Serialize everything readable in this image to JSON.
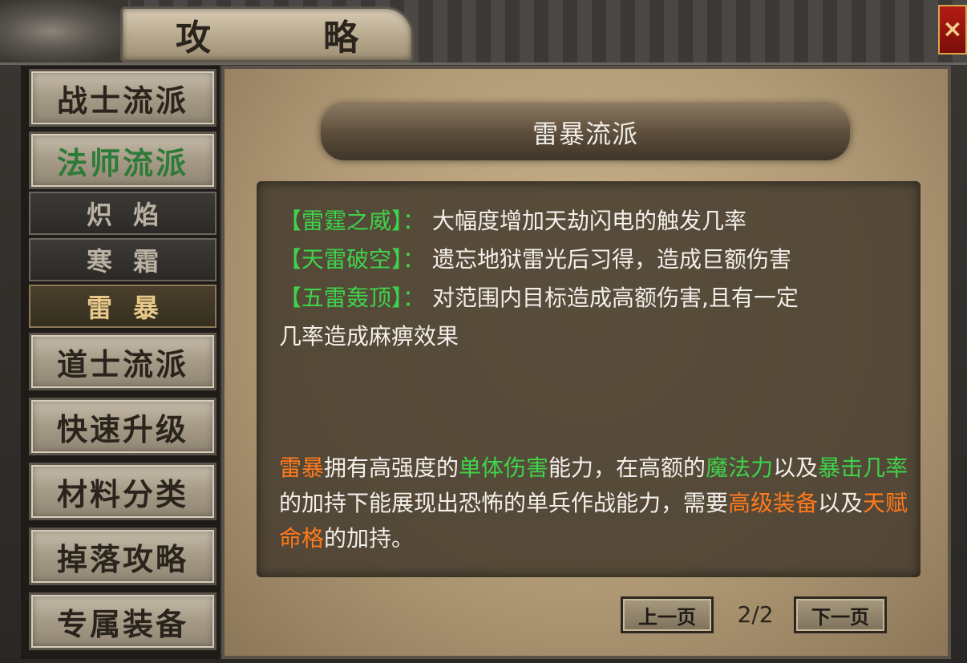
{
  "window": {
    "title": "攻　略",
    "close_label": "×"
  },
  "sidebar": {
    "items": [
      {
        "label": "战士流派",
        "active": false
      },
      {
        "label": "法师流派",
        "active": true
      },
      {
        "label": "炽焰",
        "sub": true,
        "active": false
      },
      {
        "label": "寒霜",
        "sub": true,
        "active": false
      },
      {
        "label": "雷暴",
        "sub": true,
        "active": true
      },
      {
        "label": "道士流派",
        "active": false
      },
      {
        "label": "快速升级",
        "active": false
      },
      {
        "label": "材料分类",
        "active": false
      },
      {
        "label": "掉落攻略",
        "active": false
      },
      {
        "label": "专属装备",
        "active": false
      }
    ]
  },
  "main": {
    "header": "雷暴流派",
    "skills": [
      {
        "name": "【雷霆之威】",
        "sep": "：",
        "text": "大幅度增加天劫闪电的触发几率"
      },
      {
        "name": "【天雷破空】",
        "sep": "：",
        "text": "遗忘地狱雷光后习得，造成巨额伤害"
      },
      {
        "name": "【五雷轰顶】",
        "sep": "：",
        "text": "对范围内目标造成高额伤害,且有一定"
      }
    ],
    "skill_continuation": "几率造成麻痹效果",
    "description": {
      "p1": "雷暴",
      "p2": "拥有高强度的",
      "p3": "单体伤害",
      "p4": "能力，在高额的",
      "p5": "魔法力",
      "p6": "以及",
      "p7": "暴击几率",
      "p8": "的加持下能展现出恐怖的单兵作战能力，需要",
      "p9": "高级装备",
      "p10": "以及",
      "p11": "天赋命格",
      "p12": "的加持。"
    },
    "pagination": {
      "prev_label": "上一页",
      "next_label": "下一页",
      "indicator": "2/2"
    }
  },
  "colors": {
    "skill_green": "#3fd24b",
    "highlight_orange": "#ff7a1c",
    "active_menu_green": "#2e7a38"
  }
}
